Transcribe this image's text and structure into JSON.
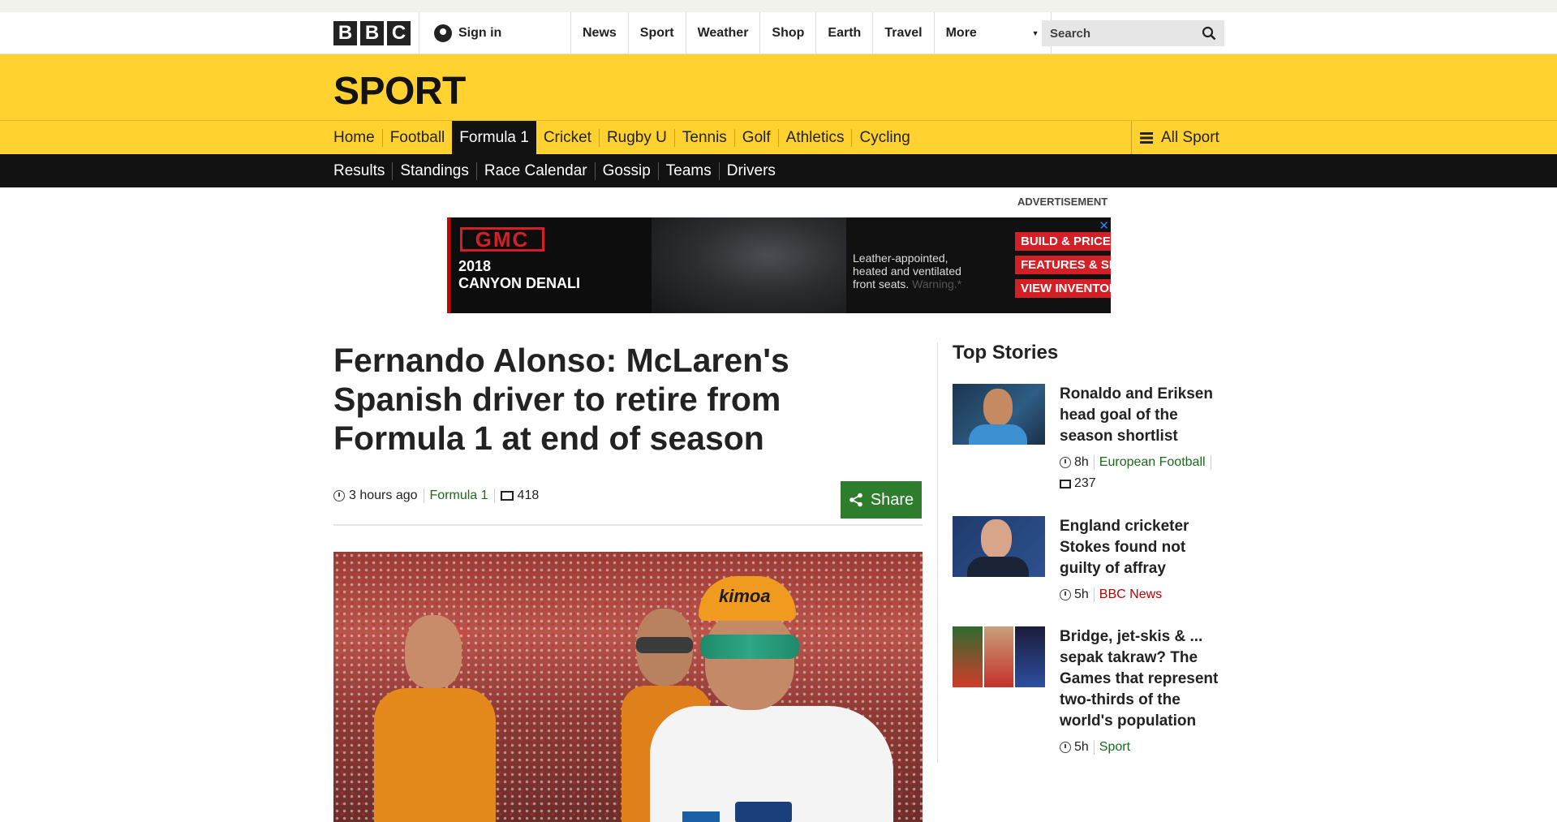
{
  "global_nav": {
    "logo_letters": [
      "B",
      "B",
      "C"
    ],
    "sign_in": "Sign in",
    "items": [
      "News",
      "Sport",
      "Weather",
      "Shop",
      "Earth",
      "Travel"
    ],
    "more": "More",
    "search_placeholder": "Search"
  },
  "sport": {
    "title": "SPORT",
    "nav": [
      "Home",
      "Football",
      "Formula 1",
      "Cricket",
      "Rugby U",
      "Tennis",
      "Golf",
      "Athletics",
      "Cycling"
    ],
    "active_nav": "Formula 1",
    "all_sport": "All Sport",
    "sub_nav": [
      "Results",
      "Standings",
      "Race Calendar",
      "Gossip",
      "Teams",
      "Drivers"
    ]
  },
  "ad": {
    "label": "ADVERTISEMENT",
    "brand": "GMC",
    "model_year": "2018",
    "model_name": "CANYON DENALI",
    "copy": "Leather-appointed, heated and ventilated front seats.",
    "copy_faint": "Warning.*",
    "ctas": [
      "BUILD & PRICE",
      "FEATURES & SPECS",
      "VIEW INVENTORY"
    ],
    "close": "✕"
  },
  "article": {
    "headline": "Fernando Alonso: McLaren's Spanish driver to retire from Formula 1 at end of season",
    "time": "3 hours ago",
    "category": "Formula 1",
    "comments": "418",
    "share": "Share",
    "hero_cap_text": "kimoa"
  },
  "top_stories": {
    "title": "Top Stories",
    "items": [
      {
        "title": "Ronaldo and Eriksen head goal of the season shortlist",
        "time": "8h",
        "category": "European Football",
        "comments": "237"
      },
      {
        "title": "England cricketer Stokes found not guilty of affray",
        "time": "5h",
        "category": "BBC News"
      },
      {
        "title": "Bridge, jet-skis & ... sepak takraw? The Games that represent two-thirds of the world's population",
        "time": "5h",
        "category": "Sport"
      }
    ]
  },
  "colors": {
    "sport_yellow": "#ffd230",
    "nav_black": "#121212",
    "share_green": "#2d7d2d",
    "link_green": "#1a6a1a",
    "news_red": "#b80000"
  }
}
